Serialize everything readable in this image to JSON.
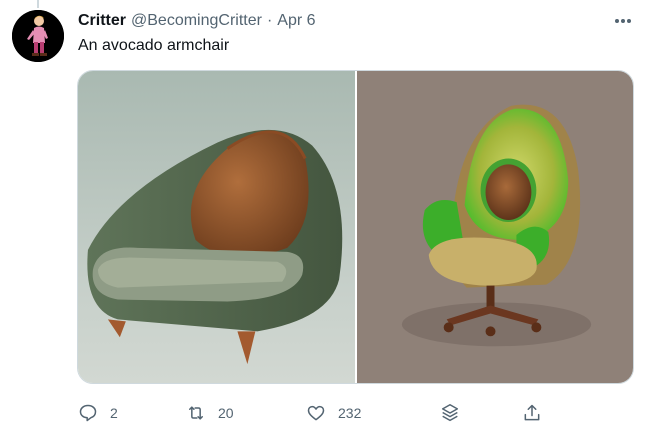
{
  "tweet": {
    "author_name": "Critter",
    "author_handle": "@BecomingCritter",
    "separator": "·",
    "date": "Apr 6",
    "text": "An avocado armchair",
    "avatar_icon": "cartoon-figure-avatar",
    "media": [
      {
        "icon": "avocado-armchair-image-1"
      },
      {
        "icon": "avocado-office-chair-image-2"
      }
    ]
  },
  "actions": {
    "reply_count": "2",
    "retweet_count": "20",
    "like_count": "232"
  },
  "colors": {
    "text_primary": "#0f1419",
    "text_secondary": "#536471",
    "border": "#cfd9de"
  }
}
